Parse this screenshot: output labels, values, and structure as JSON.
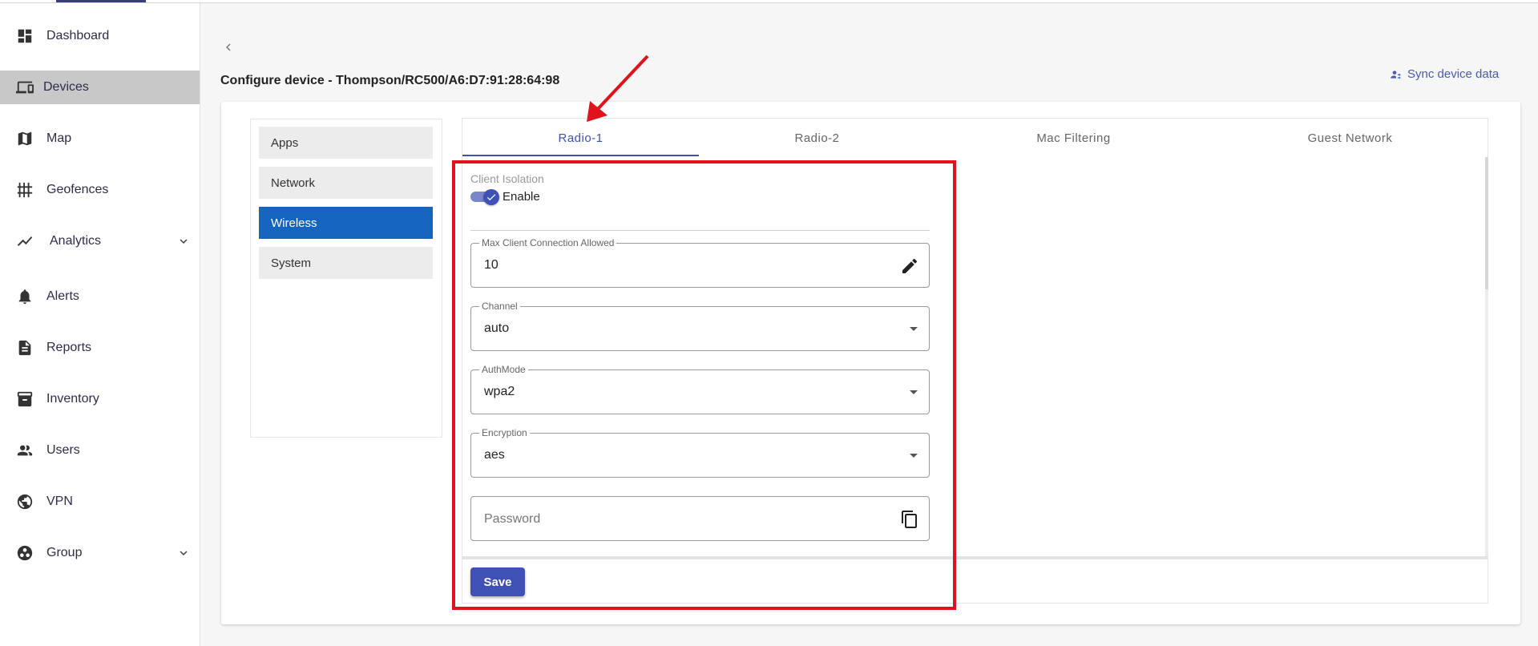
{
  "sidebar": {
    "items": [
      {
        "label": "Dashboard",
        "icon": "dashboard-icon"
      },
      {
        "label": "Devices",
        "icon": "devices-icon"
      },
      {
        "label": "Map",
        "icon": "map-icon"
      },
      {
        "label": "Geofences",
        "icon": "geofence-icon"
      },
      {
        "label": "Analytics",
        "icon": "analytics-icon"
      },
      {
        "label": "Alerts",
        "icon": "bell-icon"
      },
      {
        "label": "Reports",
        "icon": "report-icon"
      },
      {
        "label": "Inventory",
        "icon": "archive-icon"
      },
      {
        "label": "Users",
        "icon": "users-icon"
      },
      {
        "label": "VPN",
        "icon": "vpn-icon"
      },
      {
        "label": "Group",
        "icon": "group-icon"
      }
    ],
    "active": "Devices"
  },
  "header": {
    "title": "Configure device - Thompson/RC500/A6:D7:91:28:64:98",
    "sync_label": "Sync device data"
  },
  "config_menu": {
    "items": [
      "Apps",
      "Network",
      "Wireless",
      "System"
    ],
    "active": "Wireless"
  },
  "tabs": {
    "items": [
      "Radio-1",
      "Radio-2",
      "Mac Filtering",
      "Guest Network"
    ],
    "active": "Radio-1"
  },
  "form": {
    "client_isolation": {
      "label": "Client Isolation",
      "toggle_label": "Enable",
      "enabled": true
    },
    "max_clients": {
      "label": "Max Client Connection Allowed",
      "value": "10"
    },
    "channel": {
      "label": "Channel",
      "value": "auto"
    },
    "auth_mode": {
      "label": "AuthMode",
      "value": "wpa2"
    },
    "encryption": {
      "label": "Encryption",
      "value": "aes"
    },
    "password": {
      "placeholder": "Password",
      "value": ""
    },
    "save_label": "Save"
  },
  "colors": {
    "accent": "#3f51b5",
    "menu_active": "#1565c0",
    "annotation": "#e0121b"
  }
}
